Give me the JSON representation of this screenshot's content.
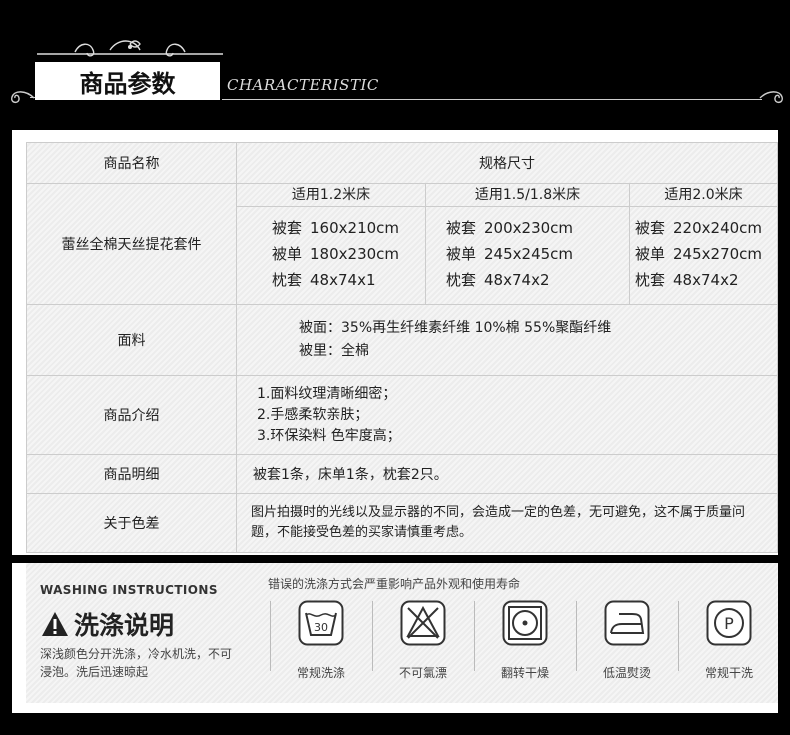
{
  "header": {
    "title": "商品参数",
    "subtitle": "CHARACTERISTIC"
  },
  "table": {
    "name_label": "商品名称",
    "spec_label": "规格尺寸",
    "product_name": "蕾丝全棉天丝提花套件",
    "sizes": [
      {
        "header": "适用1.2米床",
        "rows": [
          [
            "被套",
            "160x210cm"
          ],
          [
            "被单",
            "180x230cm"
          ],
          [
            "枕套",
            "48x74x1"
          ]
        ]
      },
      {
        "header": "适用1.5/1.8米床",
        "rows": [
          [
            "被套",
            "200x230cm"
          ],
          [
            "被单",
            "245x245cm"
          ],
          [
            "枕套",
            "48x74x2"
          ]
        ]
      },
      {
        "header": "适用2.0米床",
        "rows": [
          [
            "被套",
            "220x240cm"
          ],
          [
            "被单",
            "245x270cm"
          ],
          [
            "枕套",
            "48x74x2"
          ]
        ]
      }
    ],
    "fabric_label": "面料",
    "fabric_lines": [
      "被面：35%再生纤维素纤维  10%棉  55%聚酯纤维",
      "被里：全棉"
    ],
    "intro_label": "商品介绍",
    "intro_lines": [
      "1.面料纹理清晰细密；",
      "2.手感柔软亲肤；",
      "3.环保染料 色牢度高；"
    ],
    "detail_label": "商品明细",
    "detail_text": "被套1条，床单1条，枕套2只。",
    "color_label": "关于色差",
    "color_text": "图片拍摄时的光线以及显示器的不同，会造成一定的色差，无可避免，这不属于质量问题，不能接受色差的买家请慎重考虑。"
  },
  "wash": {
    "en_title": "WASHING INSTRUCTIONS",
    "cn_title": "洗涤说明",
    "note": "深浅颜色分开洗涤，冷水机洗，不可浸泡。洗后迅速晾起",
    "warning": "错误的洗涤方式会严重影响产品外观和使用寿命",
    "icons": [
      {
        "name": "wash-30-icon",
        "label": "常规洗涤",
        "text": "30"
      },
      {
        "name": "no-bleach-icon",
        "label": "不可氯漂"
      },
      {
        "name": "tumble-dry-icon",
        "label": "翻转干燥"
      },
      {
        "name": "low-iron-icon",
        "label": "低温熨烫"
      },
      {
        "name": "dry-clean-icon",
        "label": "常规干洗",
        "text": "P"
      }
    ]
  }
}
